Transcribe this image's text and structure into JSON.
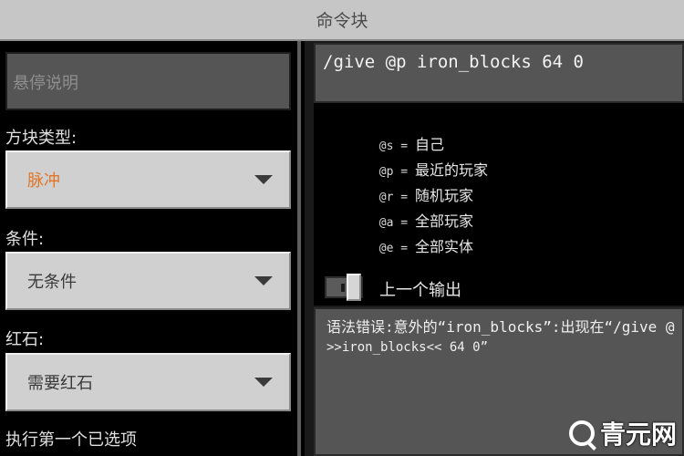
{
  "window": {
    "title": "命令块"
  },
  "left_panel": {
    "hover_note_placeholder": "悬停说明",
    "block_type": {
      "label": "方块类型:",
      "value": "脉冲",
      "value_color": "#e0762a"
    },
    "condition": {
      "label": "条件:",
      "value": "无条件"
    },
    "redstone": {
      "label": "红石:",
      "value": "需要红石"
    },
    "execute_first": {
      "label": "执行第一个已选项"
    }
  },
  "right_panel": {
    "command_value": "/give @p iron_blocks 64 0",
    "selector_help": [
      {
        "sym": "@s",
        "eq": " = ",
        "desc": "自己"
      },
      {
        "sym": "@p",
        "eq": " = ",
        "desc": "最近的玩家"
      },
      {
        "sym": "@r",
        "eq": " = ",
        "desc": "随机玩家"
      },
      {
        "sym": "@a",
        "eq": " = ",
        "desc": "全部玩家"
      },
      {
        "sym": "@e",
        "eq": " = ",
        "desc": "全部实体"
      }
    ],
    "previous_output": {
      "label": "上一个输出",
      "enabled": false
    },
    "output_lines": [
      "语法错误:意外的“iron_blocks”:出现在“/give @",
      ">>iron_blocks<< 64 0”"
    ]
  },
  "watermark": {
    "text": "青元网",
    "icon": "magnifier-logo-icon"
  }
}
